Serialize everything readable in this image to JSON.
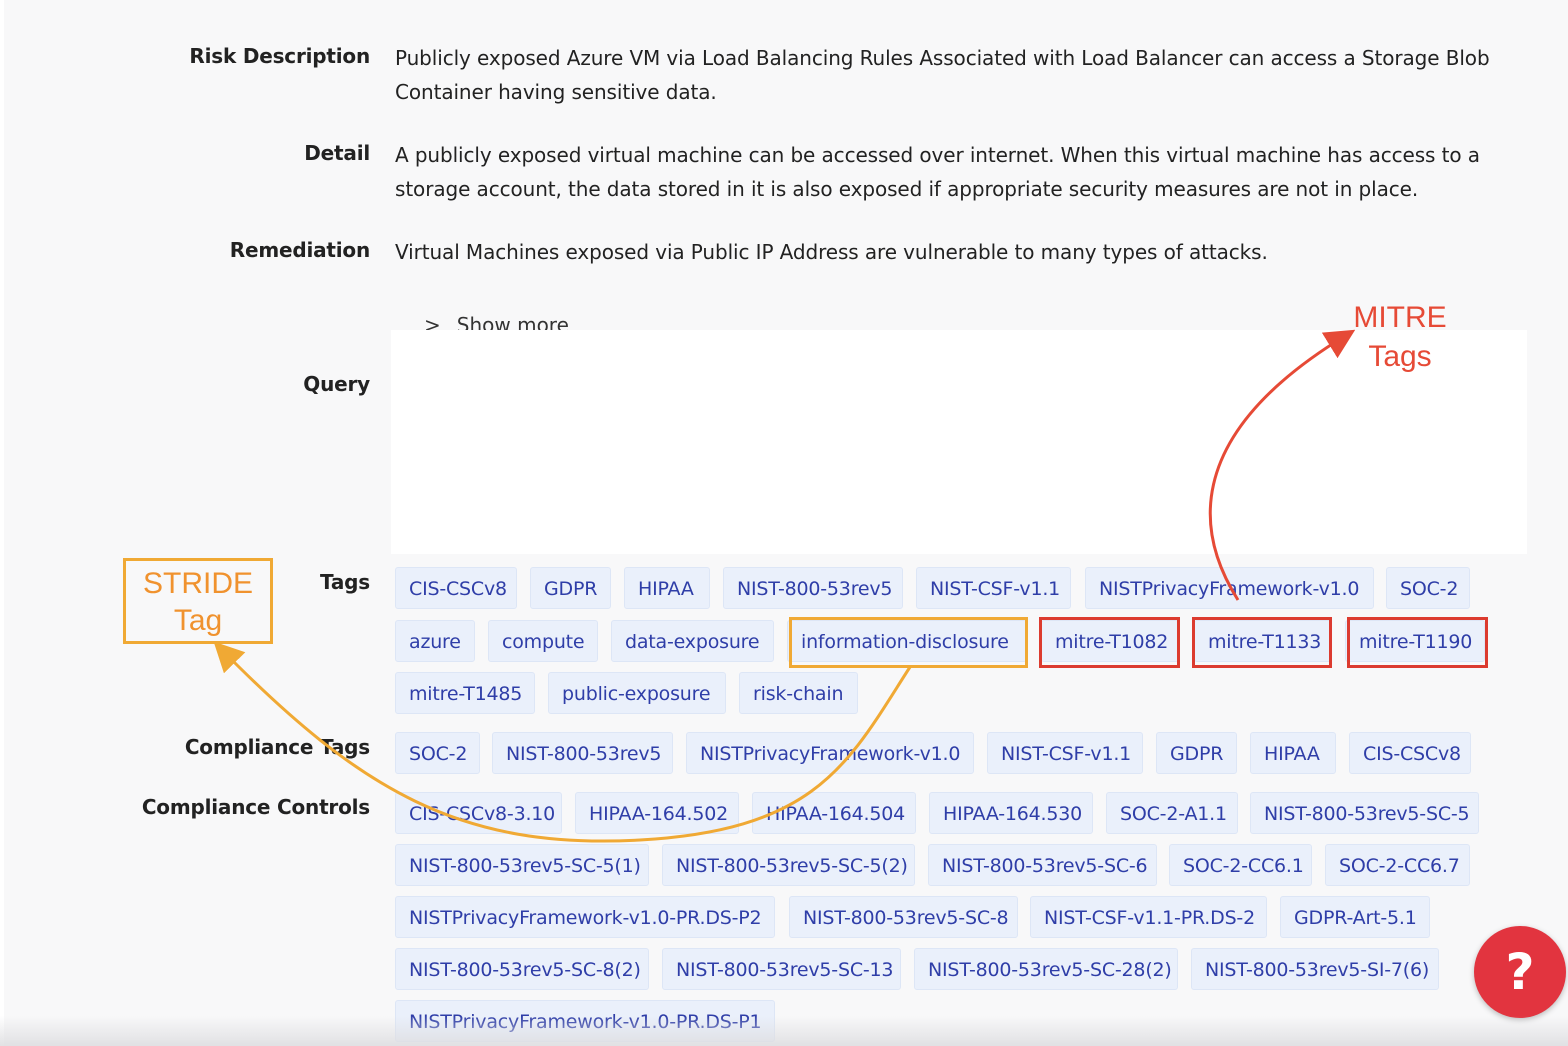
{
  "labels": {
    "risk_description": "Risk Description",
    "detail": "Detail",
    "remediation": "Remediation",
    "query": "Query",
    "tags": "Tags",
    "compliance_tags": "Compliance Tags",
    "compliance_controls": "Compliance Controls"
  },
  "risk_description_line1": "Publicly exposed Azure VM via Load Balancing Rules Associated with Load Balancer can access a Storage Blob",
  "risk_description_line2": "Container having sensitive data.",
  "detail_line1": "A publicly exposed virtual machine can be accessed over internet. When this virtual machine has access to a",
  "detail_line2": "storage account, the data stored in it is also exposed if appropriate security measures are not in place.",
  "remediation": "Virtual Machines exposed via Public IP Address are vulnerable to many types of attacks.",
  "show_more": "Show more",
  "show_more_icon": "chevron-right-icon",
  "tags": [
    "CIS-CSCv8",
    "GDPR",
    "HIPAA",
    "NIST-800-53rev5",
    "NIST-CSF-v1.1",
    "NISTPrivacyFramework-v1.0",
    "SOC-2",
    "azure",
    "compute",
    "data-exposure",
    "information-disclosure",
    "mitre-T1082",
    "mitre-T1133",
    "mitre-T1190",
    "mitre-T1485",
    "public-exposure",
    "risk-chain"
  ],
  "compliance_tags": [
    "SOC-2",
    "NIST-800-53rev5",
    "NISTPrivacyFramework-v1.0",
    "NIST-CSF-v1.1",
    "GDPR",
    "HIPAA",
    "CIS-CSCv8"
  ],
  "compliance_controls": [
    "CIS-CSCv8-3.10",
    "HIPAA-164.502",
    "HIPAA-164.504",
    "HIPAA-164.530",
    "SOC-2-A1.1",
    "NIST-800-53rev5-SC-5",
    "NIST-800-53rev5-SC-5(1)",
    "NIST-800-53rev5-SC-5(2)",
    "NIST-800-53rev5-SC-6",
    "SOC-2-CC6.1",
    "SOC-2-CC6.7",
    "NISTPrivacyFramework-v1.0-PR.DS-P2",
    "NIST-800-53rev5-SC-8",
    "NIST-CSF-v1.1-PR.DS-2",
    "GDPR-Art-5.1",
    "NIST-800-53rev5-SC-8(2)",
    "NIST-800-53rev5-SC-13",
    "NIST-800-53rev5-SC-28(2)",
    "NIST-800-53rev5-SI-7(6)",
    "NISTPrivacyFramework-v1.0-PR.DS-P1"
  ],
  "annotations": {
    "stride_line1": "STRIDE",
    "stride_line2": "Tag",
    "mitre_line1": "MITRE",
    "mitre_line2": "Tags"
  },
  "help_button": "?",
  "colors": {
    "tag_bg": "#eaf0fb",
    "tag_text": "#2f3ea8",
    "stride_annotation": "#f0a934",
    "mitre_annotation": "#dc3b2f",
    "help_button": "#e2343f"
  }
}
